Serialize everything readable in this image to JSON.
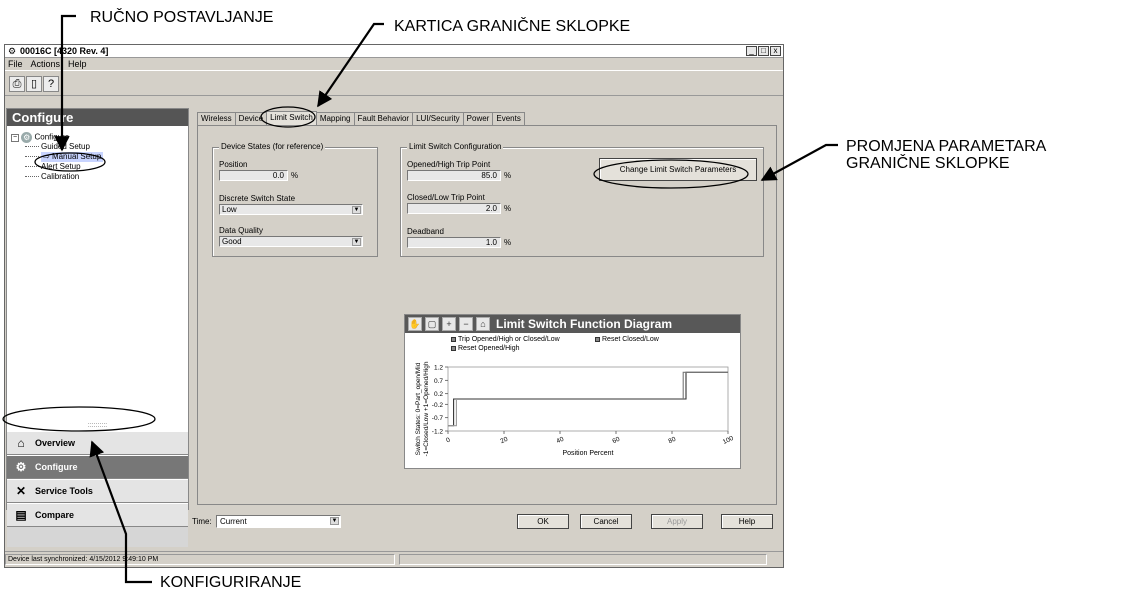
{
  "annotations": {
    "manual_setup": "RUČNO POSTAVLJANJE",
    "limit_switch_tab": "KARTICA GRANIČNE SKLOPKE",
    "change_params_line1": "PROMJENA PARAMETARA",
    "change_params_line2": "GRANIČNE SKLOPKE",
    "configure": "KONFIGURIRANJE"
  },
  "window": {
    "title": "00016C [4320 Rev. 4]",
    "min_icon": "_",
    "max_icon": "□",
    "close_icon": "x"
  },
  "menu": [
    "File",
    "Actions",
    "Help"
  ],
  "toolbar": {
    "icons": [
      "print-icon",
      "print-preview-icon",
      "context-help-icon"
    ]
  },
  "left_pane": {
    "header": "Configure",
    "tree": {
      "root": "Configure",
      "items": [
        "Guided Setup",
        "Manual Setup",
        "Alert Setup",
        "Calibration"
      ],
      "selected": "Manual Setup"
    },
    "splitter": "::::::::::",
    "nav": [
      "Overview",
      "Configure",
      "Service Tools",
      "Compare"
    ],
    "active_nav": "Configure"
  },
  "tabs": [
    "Wireless",
    "Device",
    "Limit Switch",
    "Mapping",
    "Fault Behavior",
    "LUI/Security",
    "Power",
    "Events"
  ],
  "selected_tab": "Limit Switch",
  "device_states": {
    "title": "Device States (for reference)",
    "position_label": "Position",
    "position_value": "0.0",
    "position_unit": "%",
    "discrete_label": "Discrete Switch State",
    "discrete_value": "Low",
    "quality_label": "Data Quality",
    "quality_value": "Good"
  },
  "limit_switch_config": {
    "title": "Limit Switch Configuration",
    "opened_label": "Opened/High Trip Point",
    "opened_value": "85.0",
    "closed_label": "Closed/Low Trip Point",
    "closed_value": "2.0",
    "deadband_label": "Deadband",
    "deadband_value": "1.0",
    "unit": "%"
  },
  "change_button": "Change Limit Switch Parameters",
  "diagram": {
    "title": "Limit Switch Function Diagram",
    "tools": [
      "hand-icon",
      "zoom-box-icon",
      "zoom-in-icon",
      "zoom-out-icon",
      "home-icon"
    ],
    "legend": {
      "trip": "Trip Opened/High or Closed/Low",
      "reset_closed": "Reset Closed/Low",
      "reset_opened": "Reset Opened/High"
    }
  },
  "chart_data": {
    "type": "line",
    "title": "Limit Switch Function Diagram",
    "xlabel": "Position Percent",
    "ylabel_line1": "Switch States: 0=Part_open/Mid",
    "ylabel_line2": "-1=Closed/Low +1=Opened/High",
    "xlim": [
      0,
      100
    ],
    "ylim": [
      -1.2,
      1.2
    ],
    "x_ticks": [
      "0",
      "20",
      "40",
      "60",
      "80",
      "100"
    ],
    "y_ticks": [
      "1.2",
      "0.7",
      "0.2",
      "-0.2",
      "-0.7",
      "-1.2"
    ],
    "series": [
      {
        "name": "Trip Opened/High or Closed/Low",
        "points": [
          [
            0,
            -1
          ],
          [
            2,
            -1
          ],
          [
            2,
            0
          ],
          [
            85,
            0
          ],
          [
            85,
            1
          ],
          [
            100,
            1
          ]
        ]
      },
      {
        "name": "Reset Closed/Low",
        "points": [
          [
            0,
            -1
          ],
          [
            3,
            -1
          ],
          [
            3,
            0
          ]
        ]
      },
      {
        "name": "Reset Opened/High",
        "points": [
          [
            84,
            0
          ],
          [
            84,
            1
          ],
          [
            100,
            1
          ]
        ]
      }
    ]
  },
  "bottom": {
    "time_label": "Time:",
    "time_value": "Current",
    "ok": "OK",
    "cancel": "Cancel",
    "apply": "Apply",
    "help": "Help"
  },
  "status": {
    "text": "Device last synchronized: 4/15/2012 9:49:10 PM"
  }
}
